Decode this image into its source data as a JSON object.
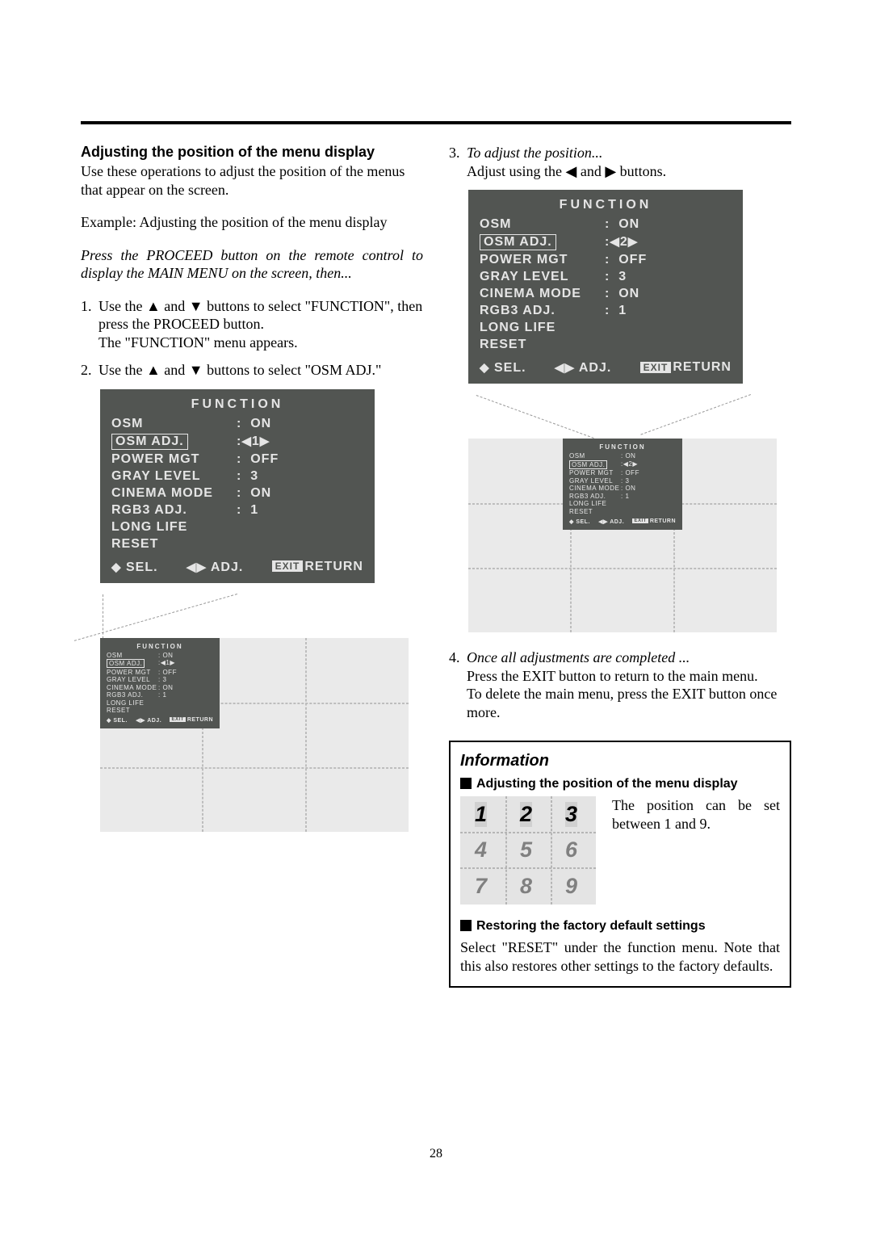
{
  "left": {
    "heading": "Adjusting the position of the menu display",
    "intro": "Use these operations to adjust the position of the menus that appear on the screen.",
    "example": "Example: Adjusting the position of the menu display",
    "press": "Press the PROCEED button on the remote control to display the MAIN MENU on the screen, then...",
    "step1": "Use the ▲ and ▼ buttons to select \"FUNCTION\", then press the PROCEED button.",
    "step1b": "The \"FUNCTION\" menu appears.",
    "step2": "Use the ▲ and ▼ buttons to select \"OSM ADJ.\""
  },
  "right": {
    "step3": "To adjust the position...",
    "step3b": "Adjust using the ◀ and ▶ buttons.",
    "step4": "Once all adjustments are completed ...",
    "step4b": "Press the EXIT button to return to the main menu.",
    "step4c": "To delete the main menu, press the EXIT button once more."
  },
  "osd": {
    "title": "FUNCTION",
    "rows": [
      {
        "label": "OSM",
        "val": "ON"
      },
      {
        "label": "OSM ADJ.",
        "val": "1",
        "sel": true,
        "arrows": true
      },
      {
        "label": "POWER MGT",
        "val": "OFF"
      },
      {
        "label": "GRAY LEVEL",
        "val": "3"
      },
      {
        "label": "CINEMA MODE",
        "val": "ON"
      },
      {
        "label": "RGB3 ADJ.",
        "val": "1"
      },
      {
        "label": "LONG LIFE",
        "val": ""
      },
      {
        "label": "RESET",
        "val": ""
      }
    ],
    "footer_sel": "SEL.",
    "footer_adj": "ADJ.",
    "footer_exit": "EXIT",
    "footer_return": "RETURN"
  },
  "osd2": {
    "rows1_val": "2"
  },
  "info": {
    "title": "Information",
    "sub1": "Adjusting the position of the menu display",
    "desc": "The position can be set between 1 and 9.",
    "sub2": "Restoring the factory default settings",
    "desc2": "Select \"RESET\" under the function menu. Note that this also restores other settings to the factory defaults."
  },
  "grid": [
    "1",
    "2",
    "3",
    "4",
    "5",
    "6",
    "7",
    "8",
    "9"
  ],
  "page": "28"
}
